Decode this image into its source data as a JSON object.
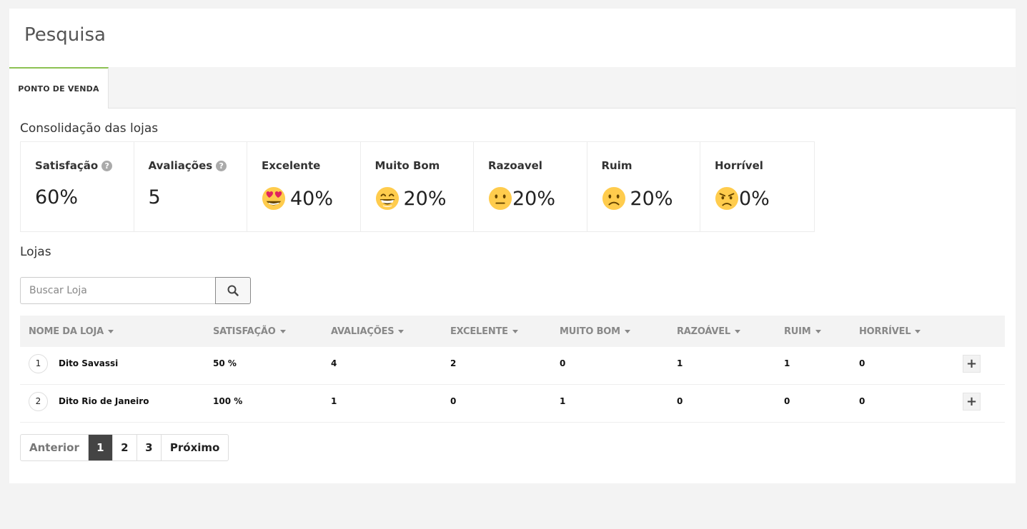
{
  "page": {
    "title": "Pesquisa"
  },
  "tabs": [
    {
      "label": "PONTO DE VENDA",
      "active": true
    }
  ],
  "consolidation": {
    "title": "Consolidação das lojas",
    "cards": [
      {
        "label": "Satisfação",
        "value": "60%",
        "help": true,
        "emoji": ""
      },
      {
        "label": "Avaliações",
        "value": "5",
        "help": true,
        "emoji": ""
      },
      {
        "label": "Excelente",
        "value": "40%",
        "help": false,
        "emoji": "heart-eyes-emoji-icon"
      },
      {
        "label": "Muito Bom",
        "value": "20%",
        "help": false,
        "emoji": "grinning-emoji-icon"
      },
      {
        "label": "Razoavel",
        "value": "20%",
        "help": false,
        "emoji": "neutral-face-emoji-icon"
      },
      {
        "label": "Ruim",
        "value": "20%",
        "help": false,
        "emoji": "frowning-emoji-icon"
      },
      {
        "label": "Horrível",
        "value": "0%",
        "help": false,
        "emoji": "angry-emoji-icon"
      }
    ]
  },
  "stores": {
    "title": "Lojas",
    "search": {
      "placeholder": "Buscar Loja",
      "value": ""
    },
    "columns": [
      "NOME DA LOJA",
      "SATISFAÇÃO",
      "AVALIAÇÕES",
      "EXCELENTE",
      "MUITO BOM",
      "RAZOÁVEL",
      "RUIM",
      "HORRÍVEL"
    ],
    "rows": [
      {
        "num": "1",
        "name": "Dito Savassi",
        "satisfacao": "50 %",
        "avaliacoes": "4",
        "excelente": "2",
        "muito_bom": "0",
        "razoavel": "1",
        "ruim": "1",
        "horrivel": "0"
      },
      {
        "num": "2",
        "name": "Dito Rio de Janeiro",
        "satisfacao": "100 %",
        "avaliacoes": "1",
        "excelente": "0",
        "muito_bom": "1",
        "razoavel": "0",
        "ruim": "0",
        "horrivel": "0"
      }
    ],
    "expand_label": "+"
  },
  "pagination": {
    "prev": "Anterior",
    "pages": [
      "1",
      "2",
      "3"
    ],
    "active": "1",
    "next": "Próximo"
  },
  "colors": {
    "tab_accent": "#8cc152",
    "active_page": "#444444",
    "emoji_yellow": "#ffcc4d",
    "heart": "#e0245e"
  }
}
